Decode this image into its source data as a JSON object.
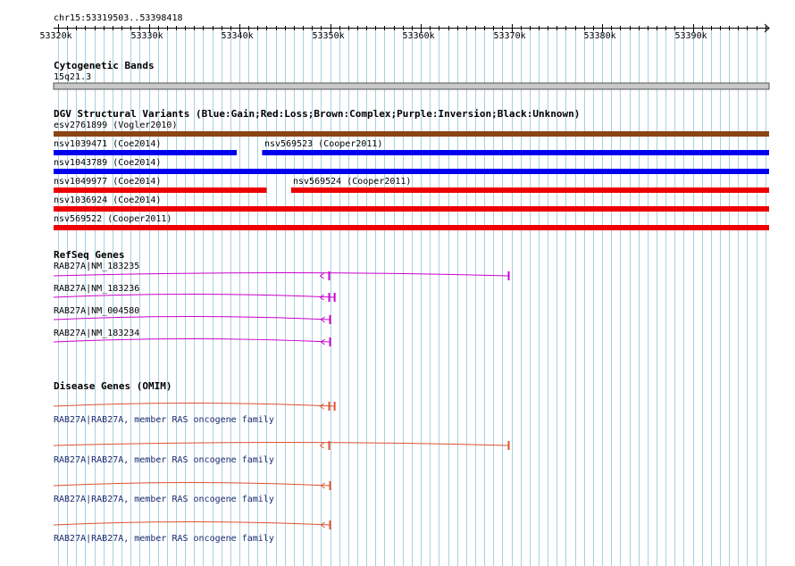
{
  "region_label": "chr15:53319503..53398418",
  "ruler": {
    "ticks": [
      "53320k",
      "53330k",
      "53340k",
      "53350k",
      "53360k",
      "53370k",
      "53380k",
      "53390k"
    ]
  },
  "cytoband": {
    "title": "Cytogenetic Bands",
    "band": "15q21.3"
  },
  "dgv": {
    "title": "DGV Structural Variants (Blue:Gain;Red:Loss;Brown:Complex;Purple:Inversion;Black:Unknown)",
    "colors": {
      "gain": "#0000ee",
      "loss": "#ee0000",
      "complex": "#8b4513"
    },
    "features": [
      {
        "label": "esv2761899 (Vogler2010)",
        "type": "complex",
        "start": 53319503,
        "end": 53398418
      },
      {
        "label": "nsv1039471 (Coe2014)",
        "type": "gain",
        "start": 53319503,
        "end": 53339700
      },
      {
        "label": "nsv569523 (Cooper2011)",
        "type": "gain",
        "start": 53342500,
        "end": 53398418
      },
      {
        "label": "nsv1043789 (Coe2014)",
        "type": "gain",
        "start": 53319503,
        "end": 53398418
      },
      {
        "label": "nsv1049977 (Coe2014)",
        "type": "loss",
        "start": 53319503,
        "end": 53343000
      },
      {
        "label": "nsv569524 (Cooper2011)",
        "type": "loss",
        "start": 53345700,
        "end": 53398418
      },
      {
        "label": "nsv1036924 (Coe2014)",
        "type": "loss",
        "start": 53319503,
        "end": 53398418
      },
      {
        "label": "nsv569522 (Cooper2011)",
        "type": "loss",
        "start": 53319503,
        "end": 53398418
      }
    ]
  },
  "refseq": {
    "title": "RefSeq Genes",
    "color": "#cc00cc",
    "transcripts": [
      {
        "label": "RAB27A|NM_183235",
        "start": 53319503,
        "end": 53369700,
        "exons": [
          53349900,
          53369700
        ]
      },
      {
        "label": "RAB27A|NM_183236",
        "start": 53319503,
        "end": 53350500,
        "exons": [
          53349900,
          53350500
        ]
      },
      {
        "label": "RAB27A|NM_004580",
        "start": 53319503,
        "end": 53350000,
        "exons": [
          53350000
        ]
      },
      {
        "label": "RAB27A|NM_183234",
        "start": 53319503,
        "end": 53350000,
        "exons": [
          53350000
        ]
      }
    ]
  },
  "omim": {
    "title": "Disease Genes (OMIM)",
    "color": "#e05030",
    "genes": [
      {
        "label": "RAB27A|RAB27A, member RAS oncogene family",
        "start": 53319503,
        "end": 53350500,
        "exons": [
          53349900,
          53350500
        ]
      },
      {
        "label": "RAB27A|RAB27A, member RAS oncogene family",
        "start": 53319503,
        "end": 53369700,
        "exons": [
          53349900,
          53369700
        ]
      },
      {
        "label": "RAB27A|RAB27A, member RAS oncogene family",
        "start": 53319503,
        "end": 53350000,
        "exons": [
          53350000
        ]
      },
      {
        "label": "RAB27A|RAB27A, member RAS oncogene family",
        "start": 53319503,
        "end": 53350000,
        "exons": [
          53350000
        ]
      }
    ]
  }
}
